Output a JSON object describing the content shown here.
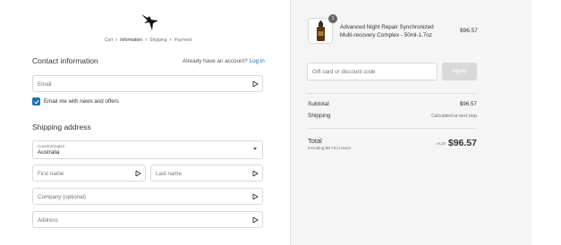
{
  "header": {
    "logo_icon": "bird-logo-icon",
    "breadcrumb": [
      "Cart",
      "Information",
      "Shipping",
      "Payment"
    ]
  },
  "contact": {
    "title": "Contact information",
    "login_prompt": "Already have an account?",
    "login_link": "Log in",
    "email_placeholder": "Email",
    "newsletter_label": "Email me with news and offers",
    "newsletter_checked": true
  },
  "shipping": {
    "title": "Shipping address",
    "country_label": "Country/region",
    "country_value": "Australia",
    "first_name_placeholder": "First name",
    "last_name_placeholder": "Last name",
    "company_placeholder": "Company (optional)",
    "address_placeholder": "Address"
  },
  "order": {
    "item": {
      "quantity": "1",
      "name": "Advanced Night Repair Synchronized Multi-recovery Complex - 50ml-1.7oz",
      "price": "$96.57"
    },
    "discount_placeholder": "Gift card or discount code",
    "apply_label": "Apply",
    "subtotal_label": "Subtotal",
    "subtotal_value": "$96.57",
    "shipping_label": "Shipping",
    "shipping_value": "Calculated at next step",
    "total_label": "Total",
    "tax_note": "Including $8.78 in taxes",
    "currency": "AUD",
    "total_value": "$96.57"
  },
  "colors": {
    "accent": "#1773b0",
    "summary_bg": "#f5f5f5",
    "border": "#d9d9d9"
  }
}
